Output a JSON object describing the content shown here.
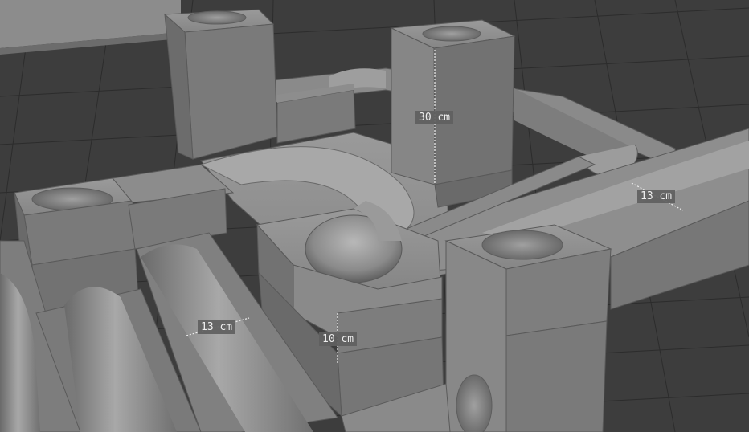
{
  "viewport": {
    "description_free": true,
    "colors": {
      "background": "#3d3d3d",
      "grid_line": "#2c2c2c",
      "object_light": "#8e8e8e",
      "object_mid": "#7a7a7a",
      "object_dark": "#666666",
      "measure_label_bg": "#606060",
      "measure_label_text": "#eeeeee",
      "measure_line": "#f0f0f0"
    }
  },
  "measurements": {
    "tower_height": "30 cm",
    "rail_width_right": "13 cm",
    "rail_width_left": "13 cm",
    "block_height": "10 cm"
  }
}
